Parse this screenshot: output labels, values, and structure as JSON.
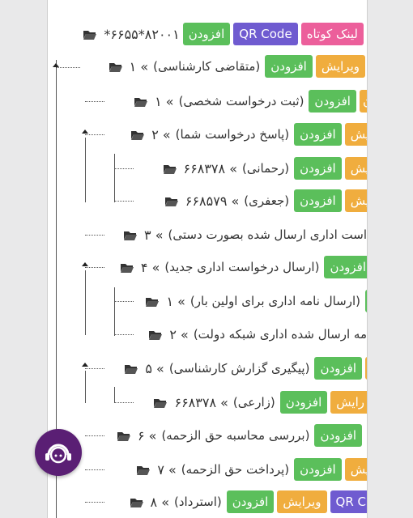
{
  "buttons": {
    "short_link": "لینک کوتاه",
    "qr": "QR Code",
    "add": "افزودن",
    "edit": "ویرایش",
    "qr_cut": "QR C"
  },
  "root": {
    "code": "*۶۶۵۵*۸۲۰۰۱"
  },
  "nodes": [
    {
      "label": "(متقاضی کارشناسی)",
      "num": "۱ «"
    },
    {
      "label": "(ثبت درخواست شخصی)",
      "num": "۱ «"
    },
    {
      "label": "(پاسخ درخواست شما)",
      "num": "۲ «"
    },
    {
      "label": "(رحمانی)",
      "num": "۶۶۸۳۷۸ «"
    },
    {
      "label": "(جعفری)",
      "num": "۶۶۸۵۷۹ «"
    },
    {
      "label": "است اداری ارسال شده بصورت دستی)",
      "num": "۳ «"
    },
    {
      "label": "(ارسال درخواست اداری جدید)",
      "num": "۴ «"
    },
    {
      "label": "(ارسال نامه اداری برای اولین بار)",
      "num": "۱ «"
    },
    {
      "label": "مه ارسال شده اداری شبکه دولت)",
      "num": "۲ «"
    },
    {
      "label": "(پیگیری گزارش کارشناسی)",
      "num": "۵ «"
    },
    {
      "label": "(زارعی)",
      "num": "۶۶۸۳۷۸ «"
    },
    {
      "label": "(بررسی محاسبه حق الزحمه)",
      "num": "۶ «"
    },
    {
      "label": "(پرداخت حق الزحمه)",
      "num": "۷ «"
    },
    {
      "label": "(استرداد)",
      "num": "۸ «"
    }
  ],
  "fragments": {
    "edit_yesh": "یش",
    "edit_rayesh": "رایش",
    "edit_n": "ن"
  },
  "colors": {
    "pink": "#ec5f9b",
    "violet": "#6f5bd0",
    "green": "#5bbf5b",
    "orange": "#f0ad3e",
    "fab": "#5a1f74"
  },
  "icons": {
    "folder": "folder-open-icon",
    "fab": "support-headset-icon"
  }
}
